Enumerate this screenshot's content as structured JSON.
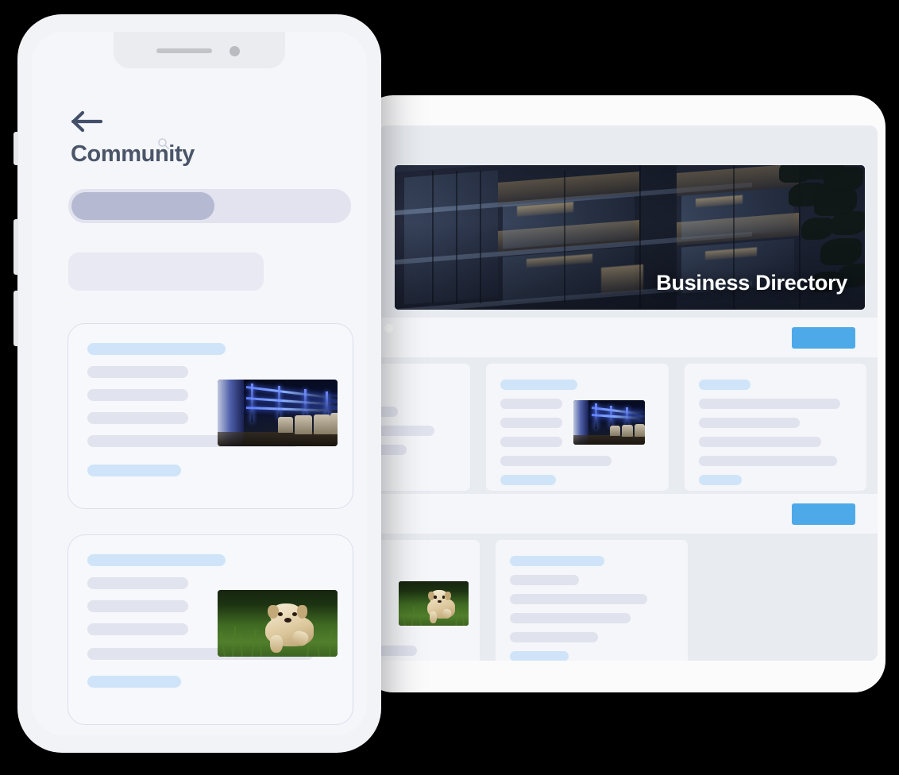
{
  "scene": {
    "background_color": "#000000",
    "description": "Device mockup: smartphone overlapping a tablet"
  },
  "tablet": {
    "device_name": "tablet",
    "screen_background": "#e8ebf0",
    "hero": {
      "title": "Business Directory",
      "image_alt": "modern apartment building at dusk",
      "title_color": "#ffffff"
    },
    "accent_color": "#4ea9e8",
    "toolbars": [
      {
        "button_label": ""
      },
      {
        "button_label": ""
      }
    ],
    "rows": [
      {
        "cards": [
          {
            "clipped": true,
            "lines": [
              {
                "tone": "gray",
                "width": "62%"
              },
              {
                "tone": "gray",
                "width": "86%"
              },
              {
                "tone": "gray",
                "width": "68%"
              }
            ]
          },
          {
            "has_thumbnail": true,
            "thumbnail_alt": "dark blue neon lounge interior",
            "lines": [
              {
                "tone": "blue",
                "width": "50%"
              },
              {
                "tone": "gray",
                "width": "40%"
              },
              {
                "tone": "gray",
                "width": "40%"
              },
              {
                "tone": "gray",
                "width": "40%"
              },
              {
                "tone": "gray",
                "width": "72%"
              },
              {
                "tone": "blue",
                "width": "36%"
              }
            ]
          },
          {
            "has_thumbnail": false,
            "lines": [
              {
                "tone": "blue",
                "width": "34%"
              },
              {
                "tone": "gray",
                "width": "92%"
              },
              {
                "tone": "gray",
                "width": "66%"
              },
              {
                "tone": "gray",
                "width": "80%"
              },
              {
                "tone": "gray",
                "width": "90%"
              },
              {
                "tone": "blue",
                "width": "28%"
              }
            ]
          }
        ]
      },
      {
        "cards": [
          {
            "clipped": true,
            "has_thumbnail": true,
            "thumbnail_alt": "golden retriever puppy running on grass",
            "lines": [
              {
                "tone": "blue",
                "width": "30%"
              },
              {
                "tone": "gray",
                "width": "70%"
              }
            ]
          },
          {
            "has_thumbnail": false,
            "lines": [
              {
                "tone": "blue",
                "width": "58%"
              },
              {
                "tone": "gray",
                "width": "42%"
              },
              {
                "tone": "gray",
                "width": "84%"
              },
              {
                "tone": "gray",
                "width": "74%"
              },
              {
                "tone": "gray",
                "width": "54%"
              },
              {
                "tone": "blue",
                "width": "36%"
              }
            ]
          }
        ]
      }
    ]
  },
  "phone": {
    "device_name": "smartphone",
    "screen_background": "#f4f6fa",
    "status": {
      "speaker": "speaker-grille",
      "camera": "front-camera"
    },
    "header": {
      "back_icon": "back-arrow-icon",
      "search_icon": "search-icon",
      "title": "Community",
      "title_color": "#4a5568"
    },
    "segmented_control": {
      "track_color": "#e2e3ef",
      "thumb_color": "#b5b9d2",
      "selected_index": 0
    },
    "filter_pill": {
      "color": "#e8e9f3"
    },
    "posts": [
      {
        "thumbnail_alt": "dark blue neon lounge interior",
        "lines": [
          {
            "tone": "blue",
            "width": "56%"
          },
          {
            "tone": "gray",
            "width": "41%"
          },
          {
            "tone": "gray",
            "width": "41%"
          },
          {
            "tone": "gray",
            "width": "41%"
          },
          {
            "tone": "gray",
            "width": "86%"
          },
          {
            "tone": "blue",
            "width": "38%"
          }
        ]
      },
      {
        "thumbnail_alt": "golden retriever puppy running on grass",
        "lines": [
          {
            "tone": "blue",
            "width": "56%"
          },
          {
            "tone": "gray",
            "width": "41%"
          },
          {
            "tone": "gray",
            "width": "41%"
          },
          {
            "tone": "gray",
            "width": "41%"
          },
          {
            "tone": "gray",
            "width": "92%"
          },
          {
            "tone": "blue",
            "width": "38%"
          }
        ]
      }
    ]
  }
}
